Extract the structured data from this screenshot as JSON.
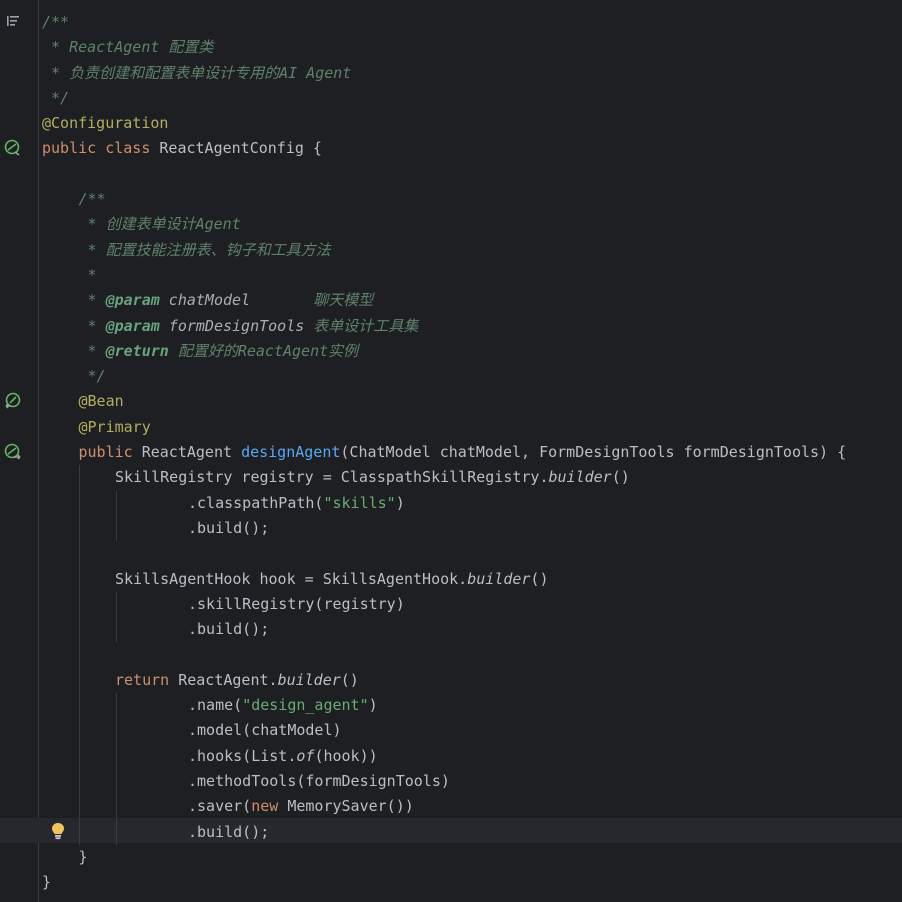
{
  "editor": {
    "current_line_index": 32,
    "lines": [
      {
        "indent": 0,
        "tokens": [
          {
            "t": "/**",
            "c": "c-doc"
          }
        ]
      },
      {
        "indent": 0,
        "tokens": [
          {
            "t": " * ReactAgent 配置类",
            "c": "c-doc"
          }
        ]
      },
      {
        "indent": 0,
        "tokens": [
          {
            "t": " * 负责创建和配置表单设计专用的AI Agent",
            "c": "c-doc"
          }
        ]
      },
      {
        "indent": 0,
        "tokens": [
          {
            "t": " */",
            "c": "c-doc"
          }
        ]
      },
      {
        "indent": 0,
        "tokens": [
          {
            "t": "@Configuration",
            "c": "c-annot"
          }
        ]
      },
      {
        "indent": 0,
        "tokens": [
          {
            "t": "public ",
            "c": "c-kw"
          },
          {
            "t": "class ",
            "c": "c-kw"
          },
          {
            "t": "ReactAgentConfig {",
            "c": "c-plain"
          }
        ]
      },
      {
        "indent": 0,
        "tokens": []
      },
      {
        "indent": 1,
        "tokens": [
          {
            "t": "/**",
            "c": "c-doc"
          }
        ]
      },
      {
        "indent": 1,
        "tokens": [
          {
            "t": " * 创建表单设计Agent",
            "c": "c-doc"
          }
        ]
      },
      {
        "indent": 1,
        "tokens": [
          {
            "t": " * 配置技能注册表、钩子和工具方法",
            "c": "c-doc"
          }
        ]
      },
      {
        "indent": 1,
        "tokens": [
          {
            "t": " *",
            "c": "c-doc"
          }
        ]
      },
      {
        "indent": 1,
        "tokens": [
          {
            "t": " * ",
            "c": "c-doc"
          },
          {
            "t": "@param",
            "c": "c-doctag"
          },
          {
            "t": " chatModel",
            "c": "c-docparam"
          },
          {
            "t": "       聊天模型",
            "c": "c-doc"
          }
        ]
      },
      {
        "indent": 1,
        "tokens": [
          {
            "t": " * ",
            "c": "c-doc"
          },
          {
            "t": "@param",
            "c": "c-doctag"
          },
          {
            "t": " formDesignTools",
            "c": "c-docparam"
          },
          {
            "t": " 表单设计工具集",
            "c": "c-doc"
          }
        ]
      },
      {
        "indent": 1,
        "tokens": [
          {
            "t": " * ",
            "c": "c-doc"
          },
          {
            "t": "@return",
            "c": "c-doctag"
          },
          {
            "t": " 配置好的ReactAgent实例",
            "c": "c-doc"
          }
        ]
      },
      {
        "indent": 1,
        "tokens": [
          {
            "t": " */",
            "c": "c-doc"
          }
        ]
      },
      {
        "indent": 1,
        "tokens": [
          {
            "t": "@Bean",
            "c": "c-annot"
          }
        ]
      },
      {
        "indent": 1,
        "tokens": [
          {
            "t": "@Primary",
            "c": "c-annot"
          }
        ]
      },
      {
        "indent": 1,
        "tokens": [
          {
            "t": "public ",
            "c": "c-kw"
          },
          {
            "t": "ReactAgent ",
            "c": "c-plain"
          },
          {
            "t": "designAgent",
            "c": "c-fn"
          },
          {
            "t": "(ChatModel chatModel, FormDesignTools formDesignTools) {",
            "c": "c-plain"
          }
        ]
      },
      {
        "indent": 2,
        "tokens": [
          {
            "t": "SkillRegistry registry = ClasspathSkillRegistry.",
            "c": "c-plain"
          },
          {
            "t": "builder",
            "c": "c-plain c-static"
          },
          {
            "t": "()",
            "c": "c-plain"
          }
        ]
      },
      {
        "indent": 4,
        "tokens": [
          {
            "t": ".classpathPath(",
            "c": "c-plain"
          },
          {
            "t": "\"skills\"",
            "c": "c-str"
          },
          {
            "t": ")",
            "c": "c-plain"
          }
        ]
      },
      {
        "indent": 4,
        "tokens": [
          {
            "t": ".build();",
            "c": "c-plain"
          }
        ]
      },
      {
        "indent": 2,
        "tokens": []
      },
      {
        "indent": 2,
        "tokens": [
          {
            "t": "SkillsAgentHook hook = SkillsAgentHook.",
            "c": "c-plain"
          },
          {
            "t": "builder",
            "c": "c-plain c-static"
          },
          {
            "t": "()",
            "c": "c-plain"
          }
        ]
      },
      {
        "indent": 4,
        "tokens": [
          {
            "t": ".skillRegistry(registry)",
            "c": "c-plain"
          }
        ]
      },
      {
        "indent": 4,
        "tokens": [
          {
            "t": ".build();",
            "c": "c-plain"
          }
        ]
      },
      {
        "indent": 2,
        "tokens": []
      },
      {
        "indent": 2,
        "tokens": [
          {
            "t": "return ",
            "c": "c-kw"
          },
          {
            "t": "ReactAgent.",
            "c": "c-plain"
          },
          {
            "t": "builder",
            "c": "c-plain c-static"
          },
          {
            "t": "()",
            "c": "c-plain"
          }
        ]
      },
      {
        "indent": 4,
        "tokens": [
          {
            "t": ".name(",
            "c": "c-plain"
          },
          {
            "t": "\"design_agent\"",
            "c": "c-str"
          },
          {
            "t": ")",
            "c": "c-plain"
          }
        ]
      },
      {
        "indent": 4,
        "tokens": [
          {
            "t": ".model(chatModel)",
            "c": "c-plain"
          }
        ]
      },
      {
        "indent": 4,
        "tokens": [
          {
            "t": ".hooks(List.",
            "c": "c-plain"
          },
          {
            "t": "of",
            "c": "c-plain c-static"
          },
          {
            "t": "(hook))",
            "c": "c-plain"
          }
        ]
      },
      {
        "indent": 4,
        "tokens": [
          {
            "t": ".methodTools(formDesignTools)",
            "c": "c-plain"
          }
        ]
      },
      {
        "indent": 4,
        "tokens": [
          {
            "t": ".saver(",
            "c": "c-plain"
          },
          {
            "t": "new ",
            "c": "c-kw"
          },
          {
            "t": "MemorySaver())",
            "c": "c-plain"
          }
        ]
      },
      {
        "indent": 4,
        "tokens": [
          {
            "t": ".build();",
            "c": "c-plain"
          }
        ]
      },
      {
        "indent": 1,
        "tokens": [
          {
            "t": "}",
            "c": "c-plain"
          }
        ]
      },
      {
        "indent": 0,
        "tokens": [
          {
            "t": "}",
            "c": "c-plain"
          }
        ]
      }
    ]
  },
  "gutter": {
    "icons": [
      {
        "name": "reader-mode-icon",
        "line": 0
      },
      {
        "name": "spring-bean-icon",
        "line": 5
      },
      {
        "name": "spring-bean-navigate-icon",
        "line": 15
      },
      {
        "name": "spring-bean-icon",
        "line": 17
      }
    ]
  },
  "intention": {
    "icon": "lightbulb-icon"
  }
}
